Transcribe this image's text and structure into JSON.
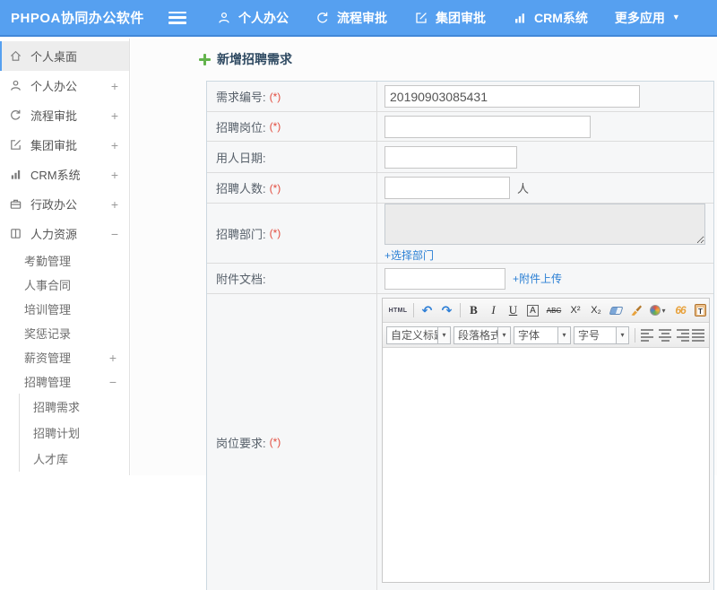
{
  "colors": {
    "accent": "#56a0f0",
    "link": "#2a7fd4",
    "required": "#e24c3f",
    "title_green": "#63b34c"
  },
  "topbar": {
    "brand": "PHPOA协同办公软件",
    "nav": [
      {
        "label": "个人办公",
        "icon": "user-icon"
      },
      {
        "label": "流程审批",
        "icon": "process-icon"
      },
      {
        "label": "集团审批",
        "icon": "edit-square-icon"
      },
      {
        "label": "CRM系统",
        "icon": "bar-chart-icon"
      },
      {
        "label": "更多应用",
        "icon": "caret-down-icon"
      }
    ]
  },
  "sidebar": {
    "items": [
      {
        "label": "个人桌面",
        "icon": "home-icon",
        "active": true
      },
      {
        "label": "个人办公",
        "icon": "user-icon",
        "toggle": "+"
      },
      {
        "label": "流程审批",
        "icon": "process-icon",
        "toggle": "+"
      },
      {
        "label": "集团审批",
        "icon": "edit-square-icon",
        "toggle": "+"
      },
      {
        "label": "CRM系统",
        "icon": "bar-chart-icon",
        "toggle": "+"
      },
      {
        "label": "行政办公",
        "icon": "briefcase-icon",
        "toggle": "+"
      },
      {
        "label": "人力资源",
        "icon": "book-icon",
        "toggle": "−"
      }
    ],
    "hr_children": [
      {
        "label": "考勤管理"
      },
      {
        "label": "人事合同"
      },
      {
        "label": "培训管理"
      },
      {
        "label": "奖惩记录"
      },
      {
        "label": "薪资管理",
        "toggle": "+"
      },
      {
        "label": "招聘管理",
        "toggle": "−"
      }
    ],
    "recruit_children": [
      {
        "label": "招聘需求"
      },
      {
        "label": "招聘计划"
      },
      {
        "label": "人才库"
      }
    ]
  },
  "main": {
    "title": "新增招聘需求",
    "form": {
      "rows": [
        {
          "label": "需求编号:",
          "required": "(*)",
          "value": "20190903085431"
        },
        {
          "label": "招聘岗位:",
          "required": "(*)",
          "value": ""
        },
        {
          "label": "用人日期:",
          "required": "",
          "value": ""
        },
        {
          "label": "招聘人数:",
          "required": "(*)",
          "value": "",
          "suffix": "人"
        },
        {
          "label": "招聘部门:",
          "required": "(*)",
          "value": "",
          "link": "+选择部门"
        },
        {
          "label": "附件文档:",
          "required": "",
          "value": "",
          "link": "+附件上传"
        },
        {
          "label": "岗位要求:",
          "required": "(*)"
        }
      ]
    },
    "editor": {
      "btn_html": "HTML",
      "icons": {
        "undo": "↶",
        "redo": "↷",
        "caret": "▾",
        "caret_big": "▼"
      },
      "btn_bold": "B",
      "btn_italic": "I",
      "btn_underline": "U",
      "btn_border_a": "A",
      "btn_strike": "ABC",
      "btn_sup": "X²",
      "btn_sub": "X₂",
      "btn_quote": "66",
      "btn_paste_t": "T",
      "btn_fontcolor": "A",
      "btn_bgcolor": "a",
      "selects": [
        "自定义标题",
        "段落格式",
        "字体",
        "字号"
      ]
    }
  }
}
